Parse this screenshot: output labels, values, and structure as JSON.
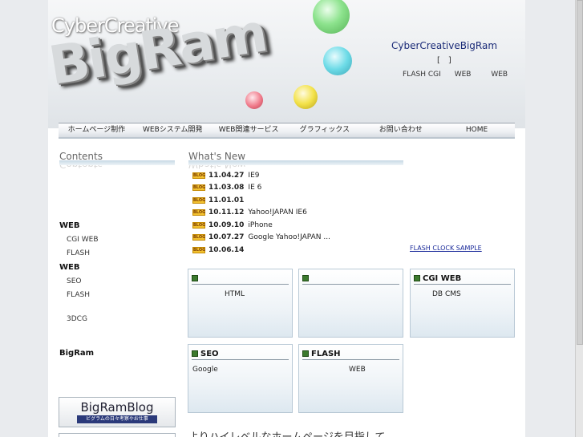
{
  "header": {
    "logo_small": "CyberCreative",
    "logo_big": "BigRam",
    "site_title": "CyberCreativeBigRam",
    "bracket": "[　]",
    "links": [
      "FLASH CGI",
      "WEB",
      "WEB"
    ]
  },
  "nav": {
    "items": [
      "ホームページ制作",
      "WEBシステム開発",
      "WEB関連サービス",
      "グラフィックス",
      "お問い合わせ",
      "HOME"
    ]
  },
  "sidebar": {
    "heading": "Contents",
    "groups": [
      {
        "label": "WEB",
        "items": [
          "CGI WEB",
          "FLASH"
        ]
      },
      {
        "label": "WEB",
        "items": [
          "SEO",
          "FLASH"
        ]
      }
    ],
    "extra_item": "3DCG",
    "bigram": "BigRam"
  },
  "whats_new": {
    "heading": "What's New",
    "icon_text": "BLOG",
    "items": [
      {
        "date": "11.04.27",
        "title": "IE9"
      },
      {
        "date": "11.03.08",
        "title": "IE 6"
      },
      {
        "date": "11.01.01",
        "title": ""
      },
      {
        "date": "10.11.12",
        "title": "Yahoo!JAPAN IE6"
      },
      {
        "date": "10.09.10",
        "title": "iPhone"
      },
      {
        "date": "10.07.27",
        "title": "Google Yahoo!JAPAN ..."
      },
      {
        "date": "10.06.14",
        "title": ""
      }
    ],
    "flash_link": "FLASH CLOCK SAMPLE"
  },
  "boxes": [
    {
      "title": "",
      "content": "HTML"
    },
    {
      "title": "",
      "content": ""
    },
    {
      "title": "CGI  WEB",
      "content": "DB CMS"
    },
    {
      "title": "SEO",
      "content": "Google"
    },
    {
      "title": "FLASH",
      "content": "WEB"
    }
  ],
  "banner": {
    "title": "BigRamBlog",
    "subtitle": "ビグラムの日々考察やお仕事"
  },
  "slogan": "よりハイレベルなホームページを目指して。",
  "colors": {
    "title_blue": "#1a2a77",
    "ball_green": "#7be07b",
    "ball_cyan": "#5fd9e6",
    "ball_yellow": "#f3e24a",
    "ball_red": "#f07a8a"
  }
}
